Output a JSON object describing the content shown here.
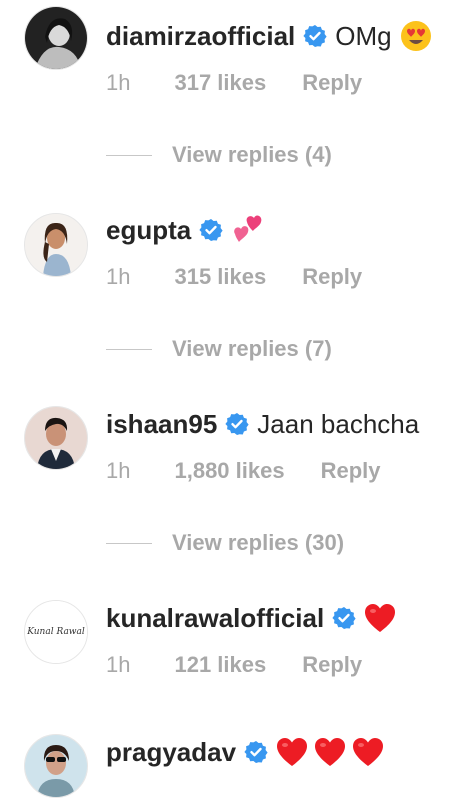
{
  "comments": [
    {
      "username": "diamirzaofficial",
      "text": "OMg",
      "emoji": "heart-eyes-face",
      "time": "1h",
      "likes": "317 likes",
      "reply": "Reply",
      "view_replies": "View replies (4)"
    },
    {
      "username": "egupta",
      "text": "",
      "emoji": "two-hearts",
      "time": "1h",
      "likes": "315 likes",
      "reply": "Reply",
      "view_replies": "View replies (7)"
    },
    {
      "username": "ishaan95",
      "text": "Jaan bachcha",
      "time": "1h",
      "likes": "1,880 likes",
      "reply": "Reply",
      "view_replies": "View replies (30)"
    },
    {
      "username": "kunalrawalofficial",
      "text": "",
      "emoji": "red-heart",
      "avatar_logo": "Kunal Rawal",
      "time": "1h",
      "likes": "121 likes",
      "reply": "Reply"
    },
    {
      "username": "pragyadav",
      "text": "",
      "emoji": "red-heart x3"
    }
  ],
  "colors": {
    "text": "#262626",
    "meta": "#a8a8a8",
    "verified": "#3897f0",
    "heart": "#ed1c24"
  }
}
